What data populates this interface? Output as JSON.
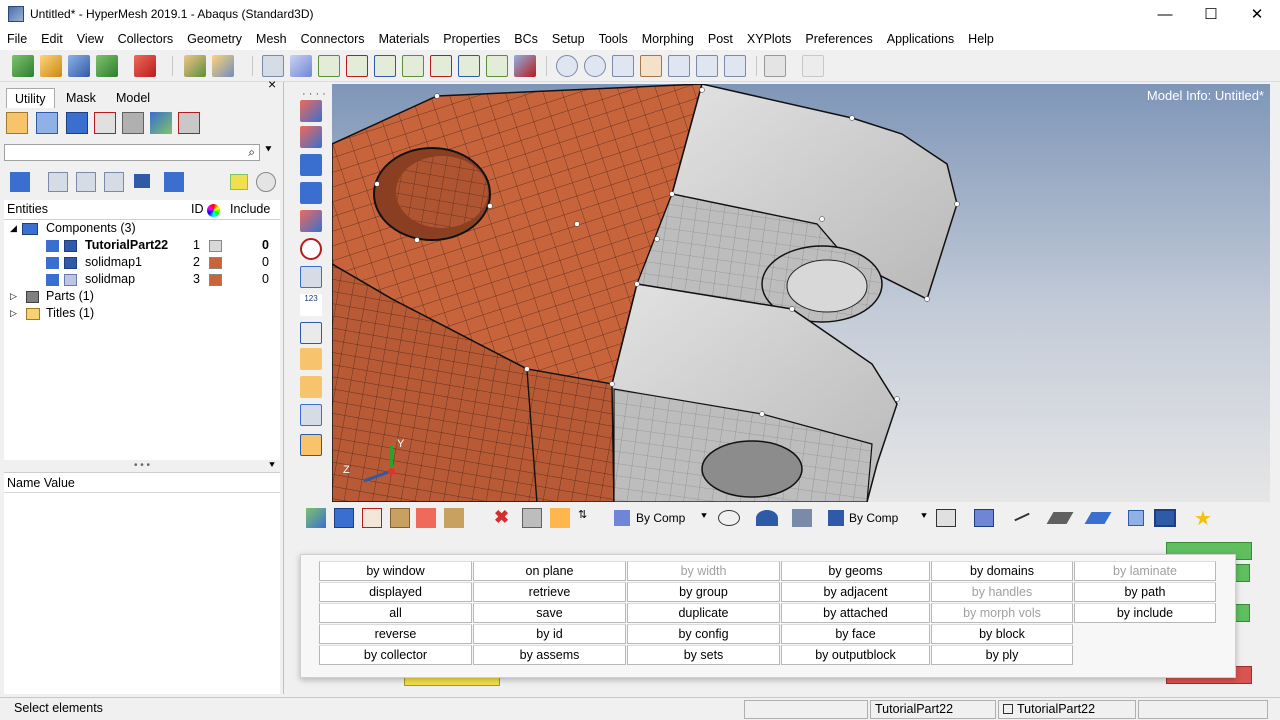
{
  "window": {
    "title": "Untitled* - HyperMesh 2019.1 - Abaqus (Standard3D)",
    "minimize_glyph": "—",
    "maximize_glyph": "☐",
    "close_glyph": "✕"
  },
  "menu": [
    "File",
    "Edit",
    "View",
    "Collectors",
    "Geometry",
    "Mesh",
    "Connectors",
    "Materials",
    "Properties",
    "BCs",
    "Setup",
    "Tools",
    "Morphing",
    "Post",
    "XYPlots",
    "Preferences",
    "Applications",
    "Help"
  ],
  "left_panel": {
    "tabs": [
      "Utility",
      "Mask",
      "Model"
    ],
    "columns": {
      "entities": "Entities",
      "id": "ID",
      "include": "Include"
    },
    "tree": [
      {
        "label": "Components (3)",
        "indent": 0,
        "kind": "group"
      },
      {
        "label": "TutorialPart22",
        "id": "1",
        "include": "0",
        "bold": true,
        "color": "#d8d8d8"
      },
      {
        "label": "solidmap1",
        "id": "2",
        "include": "0",
        "color": "#c8643c"
      },
      {
        "label": "solidmap",
        "id": "3",
        "include": "0",
        "color": "#c8643c"
      },
      {
        "label": "Parts (1)",
        "indent": 0,
        "kind": "group"
      },
      {
        "label": "Titles (1)",
        "indent": 0,
        "kind": "group"
      }
    ],
    "name_value_header": "Name Value"
  },
  "viewport": {
    "model_info": "Model Info: Untitled*",
    "axis_y": "Y",
    "axis_z": "Z"
  },
  "bottom_toolbar": {
    "by_comp_1": "By Comp",
    "by_comp_2": "By Comp"
  },
  "popup": {
    "rows": [
      [
        "by window",
        "on plane",
        "by width",
        "by geoms",
        "by domains",
        "by laminate"
      ],
      [
        "displayed",
        "retrieve",
        "by group",
        "by adjacent",
        "by handles",
        "by path"
      ],
      [
        "all",
        "save",
        "duplicate",
        "by attached",
        "by morph vols",
        "by include"
      ],
      [
        "reverse",
        "by id",
        "by config",
        "by face",
        "by block",
        ""
      ],
      [
        "by collector",
        "by assems",
        "by sets",
        "by outputblock",
        "by ply",
        ""
      ]
    ],
    "disabled": [
      "by width",
      "by laminate",
      "by handles",
      "by morph vols"
    ]
  },
  "status": {
    "message": "Select elements",
    "comp_left": "TutorialPart22",
    "comp_right": "TutorialPart22"
  },
  "colors": {
    "mesh_orange": "#c8643c",
    "mesh_grey": "#c9c9c9",
    "green": "#5fbf5f"
  }
}
